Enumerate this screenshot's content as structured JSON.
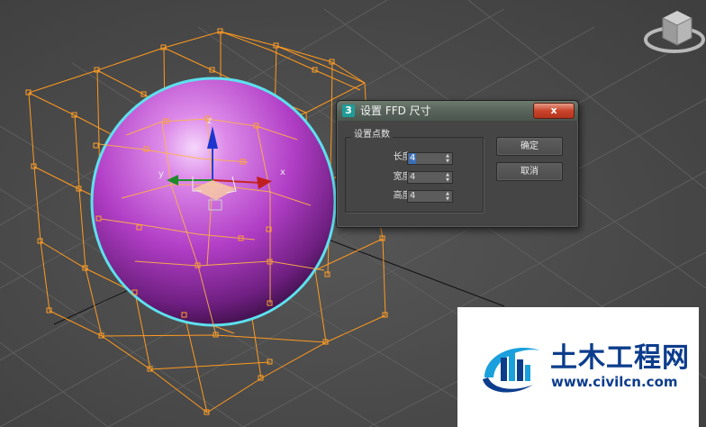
{
  "viewport": {
    "axis_labels": {
      "x": "x",
      "y": "y",
      "z": "z"
    }
  },
  "dialog": {
    "app_icon_text": "3",
    "title": "设置 FFD 尺寸",
    "close_label": "x",
    "group_label": "设置点数",
    "fields": [
      {
        "label": "长度:",
        "value": "4"
      },
      {
        "label": "宽度:",
        "value": "4"
      },
      {
        "label": "高度:",
        "value": "4"
      }
    ],
    "ok_label": "确定",
    "cancel_label": "取消"
  },
  "watermark": {
    "text": "土木工程网",
    "url": "www.civilcn.com"
  },
  "icons": {
    "view_cube": "view-cube-icon",
    "logo": "civilcn-logo-icon",
    "app": "3dsmax-app-icon"
  },
  "colors": {
    "viewport_bg": "#4b4b4b",
    "lattice": "#ff9a1f",
    "sphere": "#b23fc8",
    "selection": "#5ee0ee",
    "dialog_bg": "#444444",
    "brand_blue": "#0c3d8c"
  }
}
